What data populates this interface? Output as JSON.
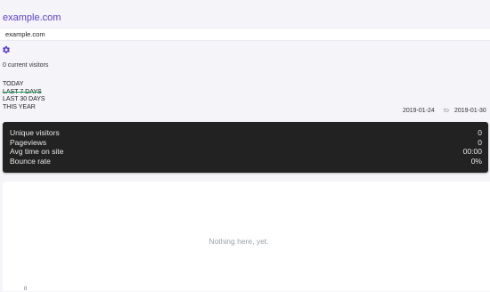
{
  "site": {
    "link_label": "example.com",
    "selected": "example.com"
  },
  "icons": {
    "settings": "gear-icon"
  },
  "realtime": {
    "current_visitors": "0 current visitors"
  },
  "ranges": [
    {
      "label": "TODAY",
      "active": false
    },
    {
      "label": "LAST 7 DAYS",
      "active": true
    },
    {
      "label": "LAST 30 DAYS",
      "active": false
    },
    {
      "label": "THIS YEAR",
      "active": false
    }
  ],
  "daterange": {
    "from": "2019-01-24",
    "to_label": "to",
    "to": "2019-01-30"
  },
  "stats": [
    {
      "label": "Unique visitors",
      "value": "0"
    },
    {
      "label": "Pageviews",
      "value": "0"
    },
    {
      "label": "Avg time on site",
      "value": "00:00"
    },
    {
      "label": "Bounce rate",
      "value": "0%"
    }
  ],
  "chart": {
    "empty_message": "Nothing here, yet.",
    "y_axis_label": "0"
  },
  "colors": {
    "accent": "#5b3fd0",
    "active_underline": "#18a058",
    "stats_bg": "#222222",
    "page_bg": "#f4f4f9"
  }
}
